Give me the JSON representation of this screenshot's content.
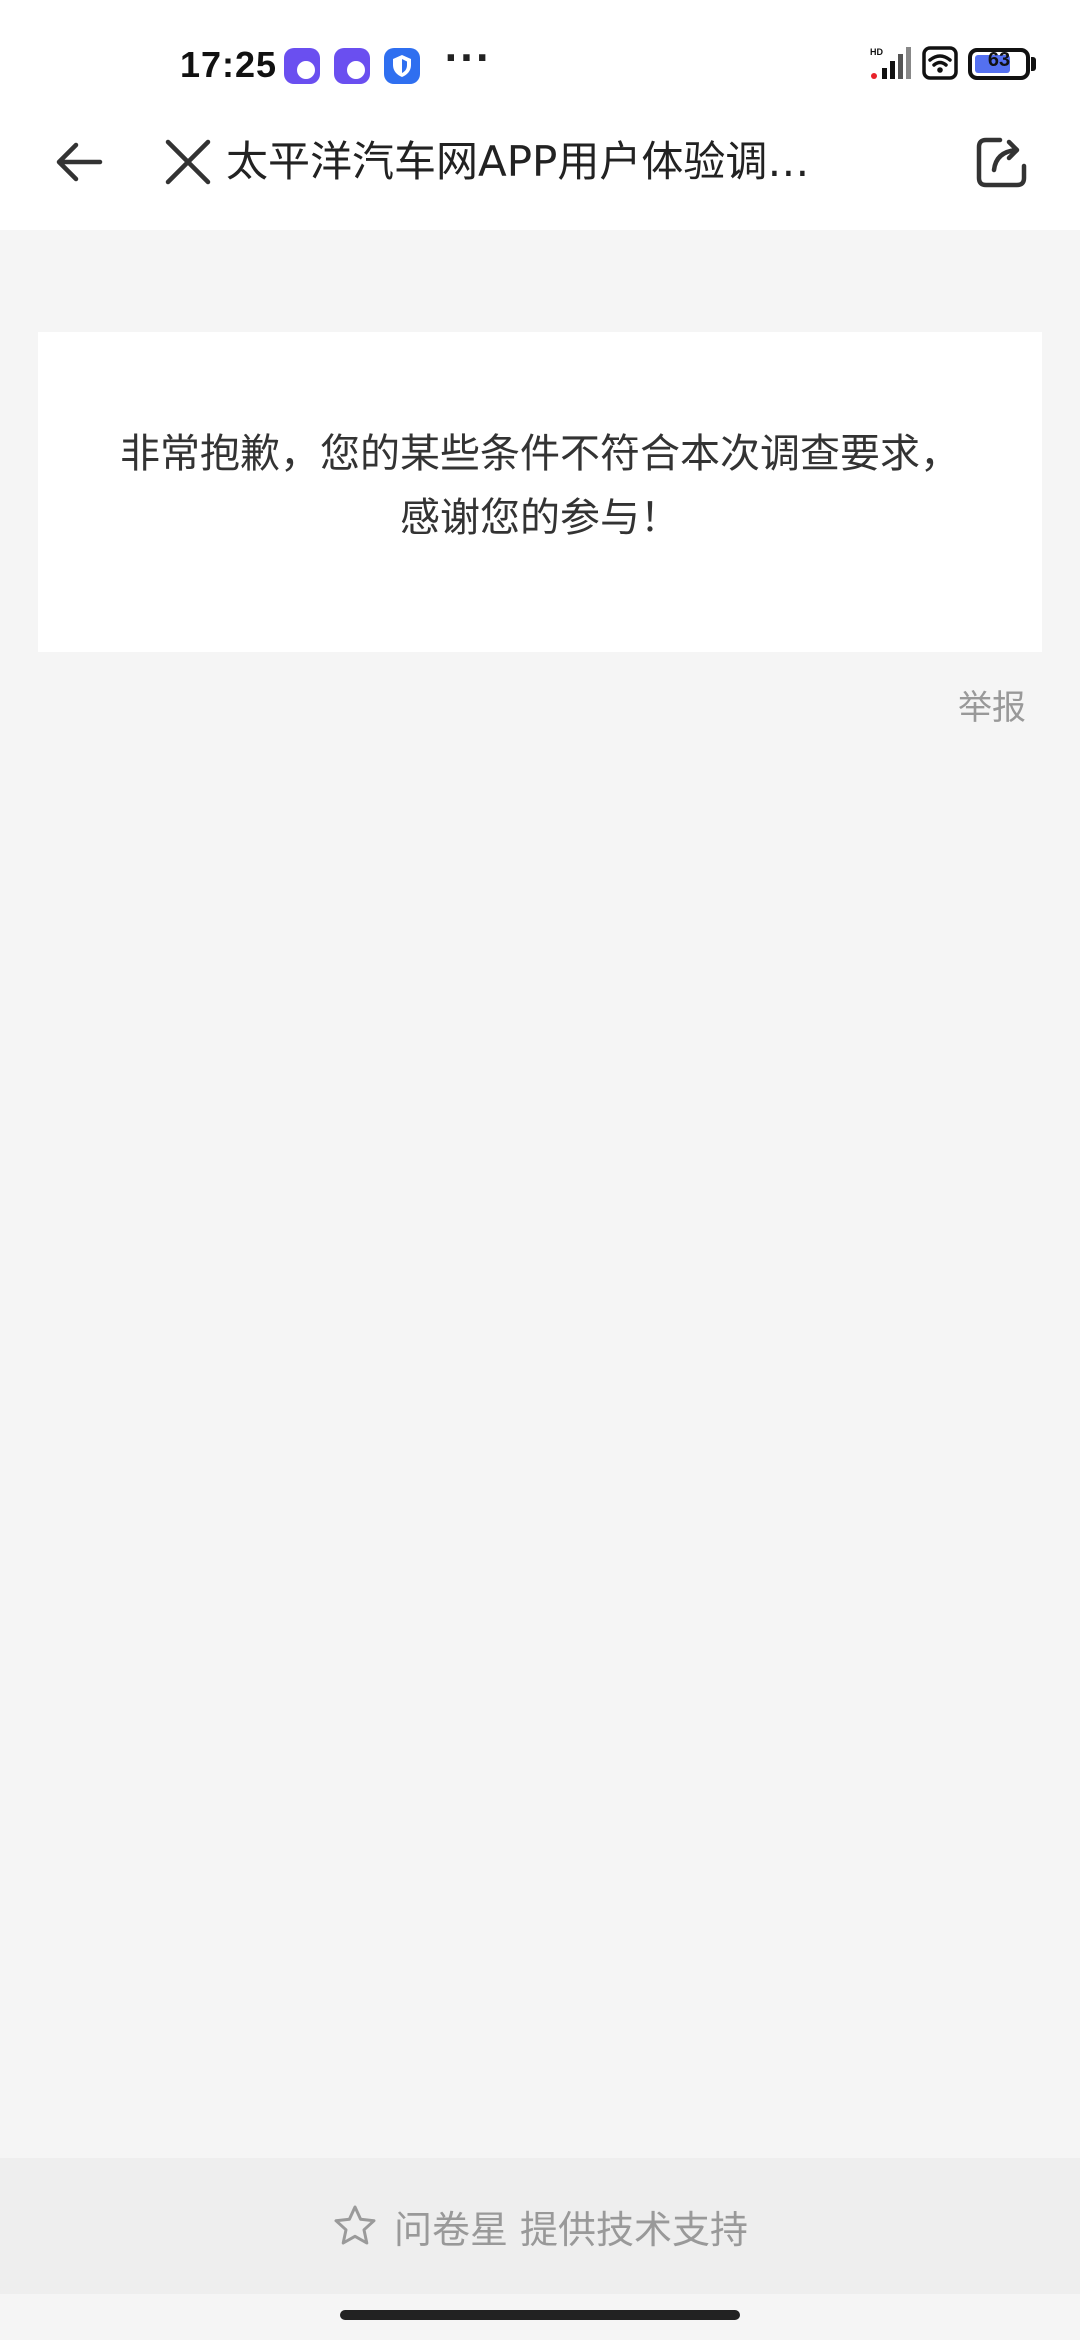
{
  "status_bar": {
    "time": "17:25",
    "dots": "···",
    "battery_level": "63",
    "icons": [
      "app-notification-icon",
      "app-notification-icon",
      "shield-icon",
      "hd-signal-icon",
      "wifi-icon",
      "battery-icon"
    ],
    "colors": {
      "purple": "#6a4ff0",
      "blue": "#2f6ff0",
      "battery": "#5470f0"
    }
  },
  "nav": {
    "title": "太平洋汽车网APP用户体验调…",
    "icons": [
      "back-arrow-icon",
      "close-icon",
      "share-icon"
    ]
  },
  "card": {
    "line1": "非常抱歉，您的某些条件不符合本次调查要求，",
    "line2": "感谢您的参与！"
  },
  "report_label": "举报",
  "footer": {
    "brand": "问卷星",
    "text": "提供技术支持",
    "icon": "star-outline-icon"
  }
}
